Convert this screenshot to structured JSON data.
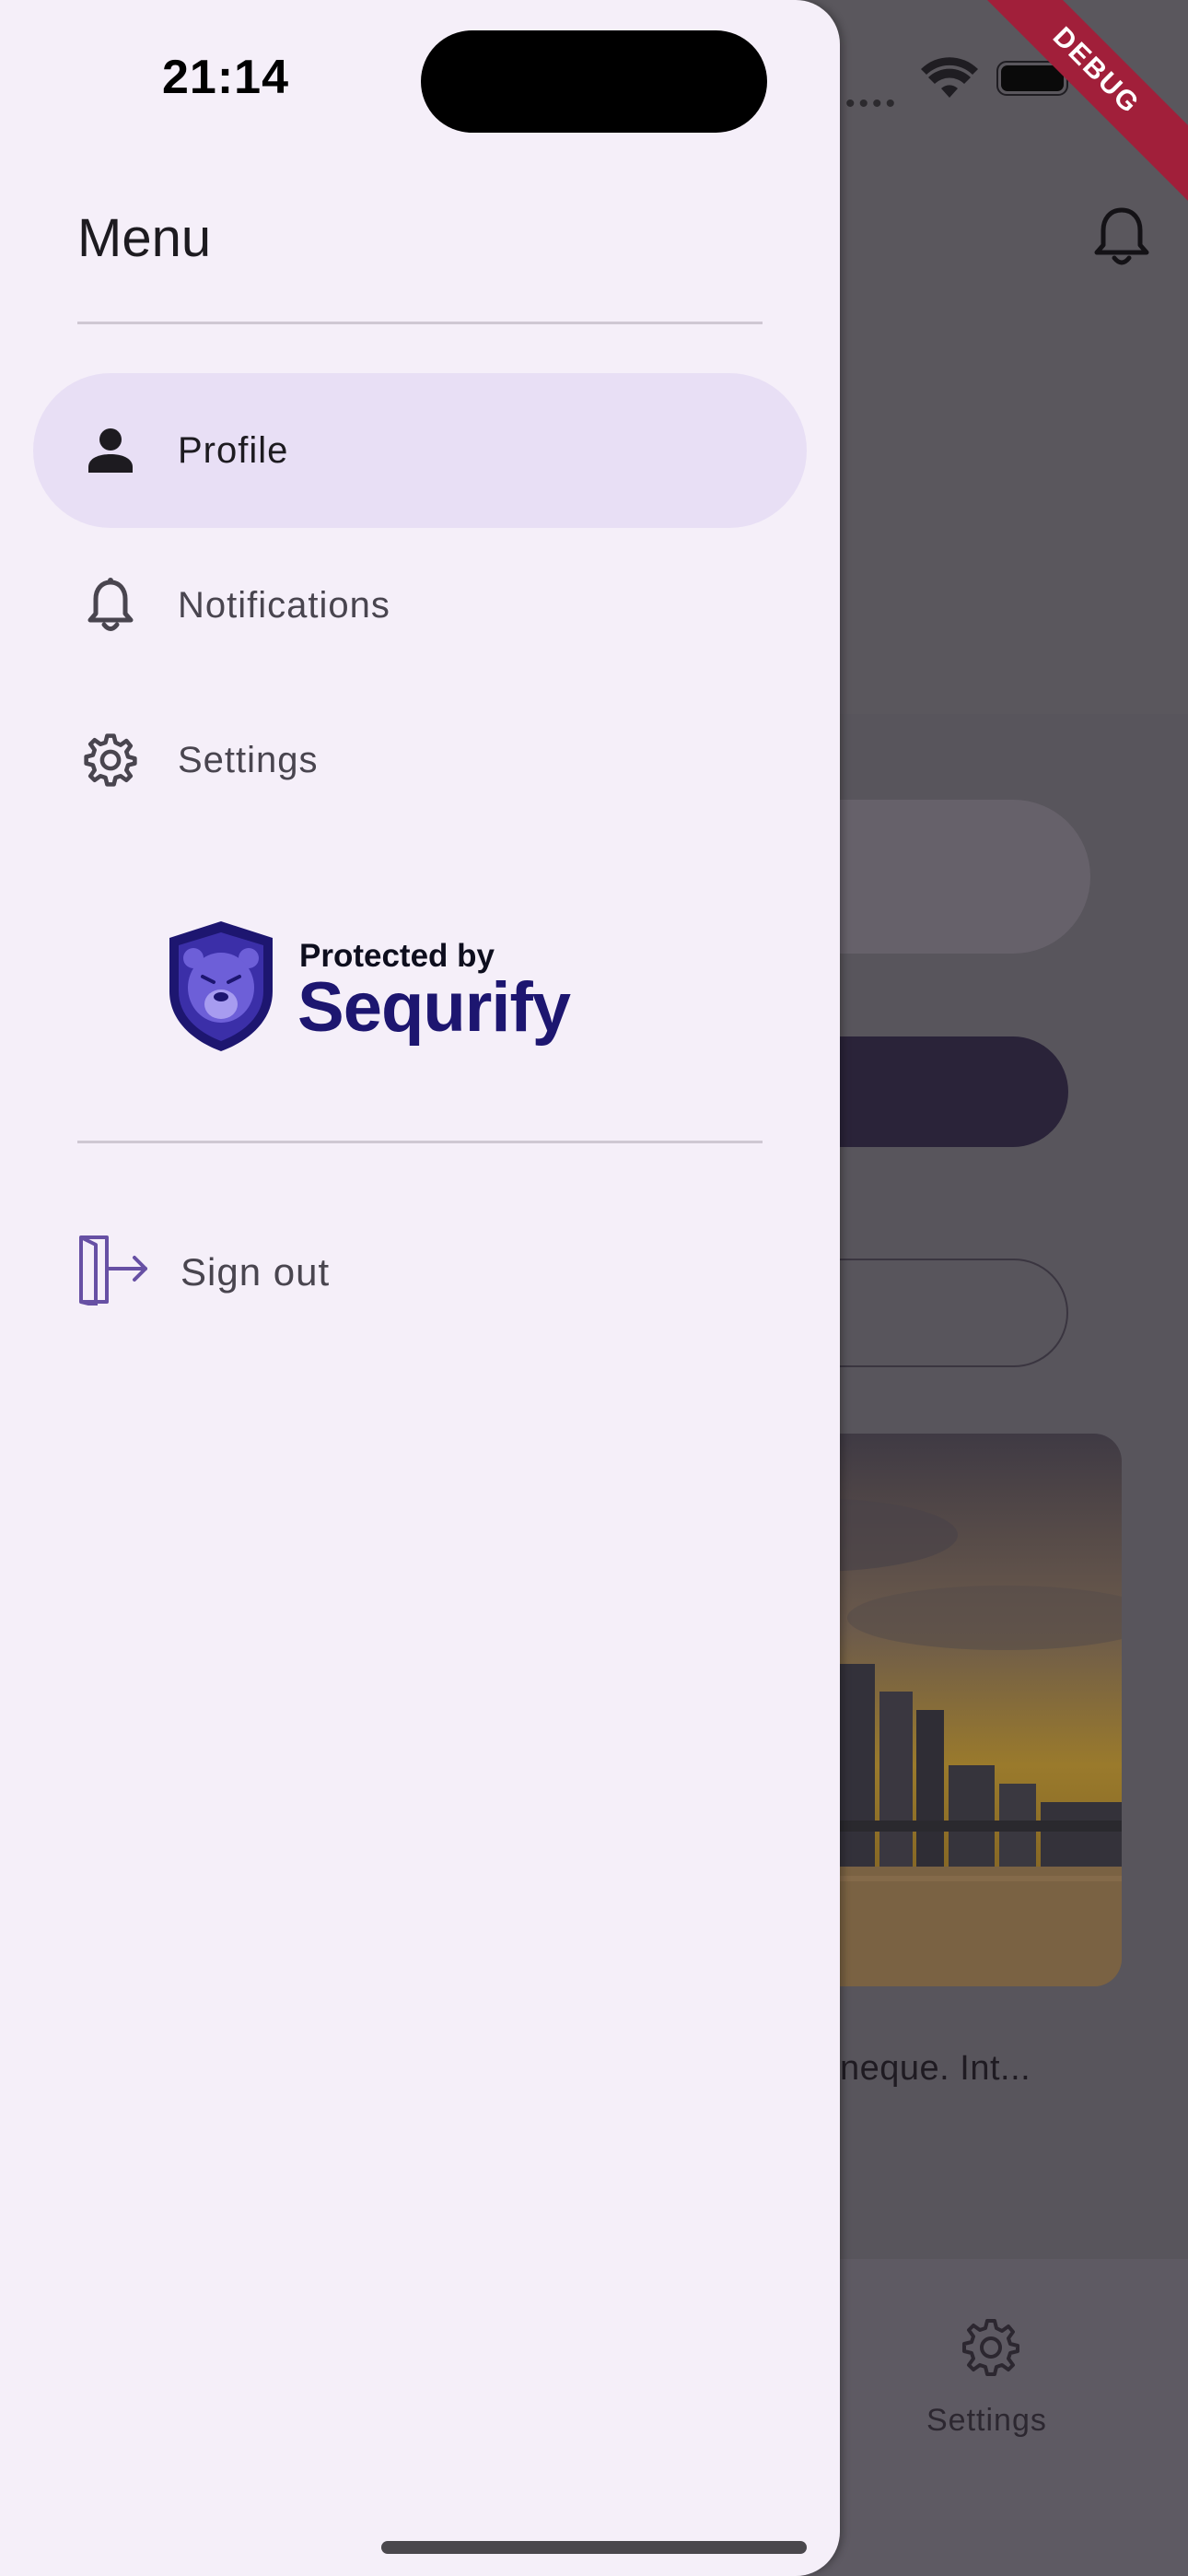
{
  "status_bar": {
    "time": "21:14"
  },
  "debug_banner": "DEBUG",
  "drawer": {
    "title": "Menu",
    "items": [
      {
        "label": "Profile",
        "icon": "person-icon",
        "active": true
      },
      {
        "label": "Notifications",
        "icon": "bell-icon",
        "active": false
      },
      {
        "label": "Settings",
        "icon": "gear-icon",
        "active": false
      }
    ],
    "logo": {
      "line1": "Protected by",
      "line2": "Sequrify"
    },
    "sign_out_label": "Sign out"
  },
  "background_app": {
    "caption_fragment": "neque. Int...",
    "bottom_nav_settings_label": "Settings"
  },
  "colors": {
    "drawer_bg": "#f5eff9",
    "active_item_bg": "#e8dff5",
    "brand_purple": "#1d1670",
    "signout_icon": "#6750a4"
  }
}
